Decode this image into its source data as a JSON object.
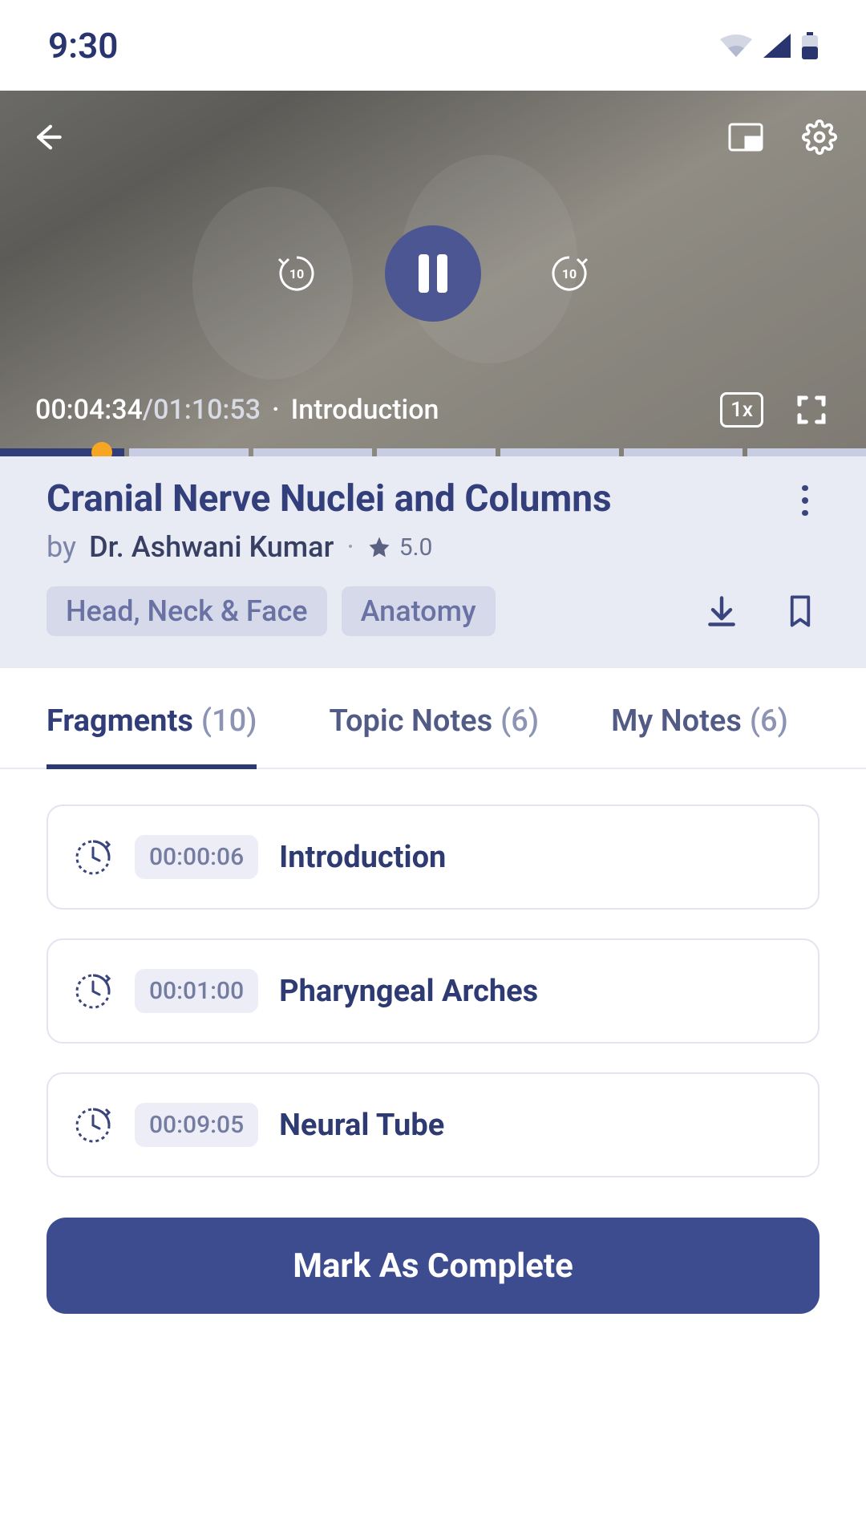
{
  "status_bar": {
    "time": "9:30"
  },
  "player": {
    "current_time": "00:04:34",
    "duration": "01:10:53",
    "chapter": "Introduction",
    "speed_label": "1x",
    "segments": 7,
    "progress_fraction_seg2": 0.0,
    "dot_position_seg1_pct": 82
  },
  "lecture": {
    "title": "Cranial Nerve Nuclei and Columns",
    "by_label": "by",
    "instructor": "Dr. Ashwani Kumar",
    "rating": "5.0",
    "tags": [
      "Head, Neck & Face",
      "Anatomy"
    ]
  },
  "tabs": [
    {
      "label": "Fragments",
      "count": "(10)",
      "active": true
    },
    {
      "label": "Topic Notes",
      "count": "(6)",
      "active": false
    },
    {
      "label": "My Notes",
      "count": "(6)",
      "active": false
    }
  ],
  "fragments": [
    {
      "time": "00:00:06",
      "title": "Introduction"
    },
    {
      "time": "00:01:00",
      "title": "Pharyngeal Arches"
    },
    {
      "time": "00:09:05",
      "title": "Neural Tube"
    }
  ],
  "complete_button": "Mark As Complete"
}
